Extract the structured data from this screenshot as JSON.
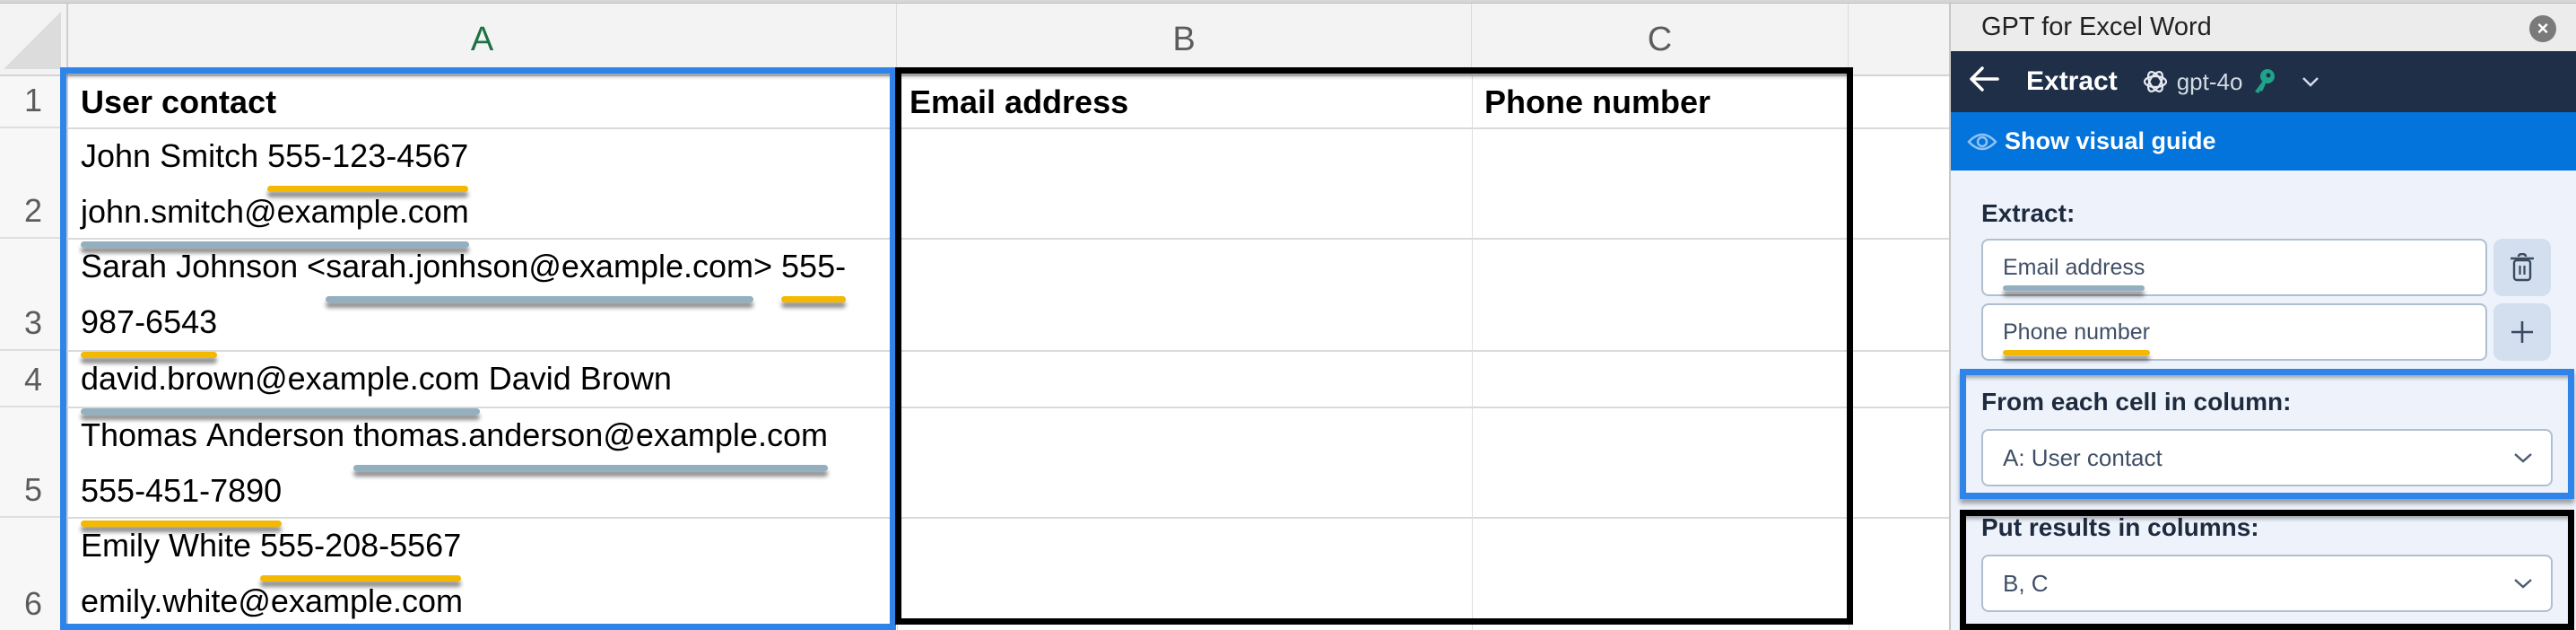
{
  "spreadsheet": {
    "columns": [
      {
        "letter": "A",
        "active": true
      },
      {
        "letter": "B",
        "active": false
      },
      {
        "letter": "C",
        "active": false
      }
    ],
    "row_numbers": [
      "1",
      "2",
      "3",
      "4",
      "5",
      "6"
    ],
    "header_row": {
      "A": "User contact",
      "B": "Email address",
      "C": "Phone number"
    },
    "rows": [
      {
        "row": "2",
        "lines": [
          [
            {
              "t": "John Smitch "
            },
            {
              "t": "555-123-4567",
              "u": "phone"
            }
          ],
          [
            {
              "t": "john.smitch@example.com",
              "u": "email"
            }
          ]
        ],
        "B": "",
        "C": ""
      },
      {
        "row": "3",
        "lines": [
          [
            {
              "t": "Sarah Johnson <"
            },
            {
              "t": "sarah.jonhson@example.com",
              "u": "email"
            },
            {
              "t": "> "
            },
            {
              "t": "555-",
              "u": "phone"
            }
          ],
          [
            {
              "t": "987-6543",
              "u": "phone"
            }
          ]
        ],
        "B": "",
        "C": ""
      },
      {
        "row": "4",
        "lines": [
          [
            {
              "t": "david.brown@example.com",
              "u": "email"
            },
            {
              "t": " David Brown"
            }
          ]
        ],
        "B": "",
        "C": ""
      },
      {
        "row": "5",
        "lines": [
          [
            {
              "t": "Thomas Anderson "
            },
            {
              "t": "thomas.anderson@example.com",
              "u": "email"
            }
          ],
          [
            {
              "t": "555-451-7890",
              "u": "phone"
            }
          ]
        ],
        "B": "",
        "C": ""
      },
      {
        "row": "6",
        "lines": [
          [
            {
              "t": "Emily White "
            },
            {
              "t": "555-208-5567",
              "u": "phone"
            }
          ],
          [
            {
              "t": "emily.white@example.com",
              "u": "email"
            }
          ]
        ],
        "B": "",
        "C": ""
      }
    ],
    "highlight_colors": {
      "phone_underline": "#f5b800",
      "email_underline": "#93b0c0",
      "source_selection": "#2f84ea",
      "target_selection": "#000000"
    }
  },
  "panel": {
    "title": "GPT for Excel Word",
    "close_icon": "close-circle-icon",
    "nav": {
      "back_icon": "arrow-left-icon",
      "title": "Extract",
      "model_icon": "openai-logo-icon",
      "model": "gpt-4o",
      "key_icon": "key-icon",
      "key_color": "#1fa38a",
      "chevron_icon": "chevron-down-icon"
    },
    "guide": {
      "icon": "eye-icon",
      "label": "Show visual guide"
    },
    "extract": {
      "label": "Extract:",
      "fields": [
        {
          "value": "Email address",
          "underline": "email",
          "action": "Delete",
          "action_icon": "trash-icon"
        },
        {
          "value": "Phone number",
          "underline": "phone",
          "action": "Add",
          "action_icon": "plus-icon"
        }
      ]
    },
    "source": {
      "label": "From each cell in column:",
      "value": "A: User contact"
    },
    "target": {
      "label": "Put results in columns:",
      "value": "B, C"
    },
    "colors": {
      "title_bar": "#ececec",
      "nav_bg": "#1f2f47",
      "guide_bg": "#0274dc",
      "body_bg": "#eef3fb"
    }
  }
}
